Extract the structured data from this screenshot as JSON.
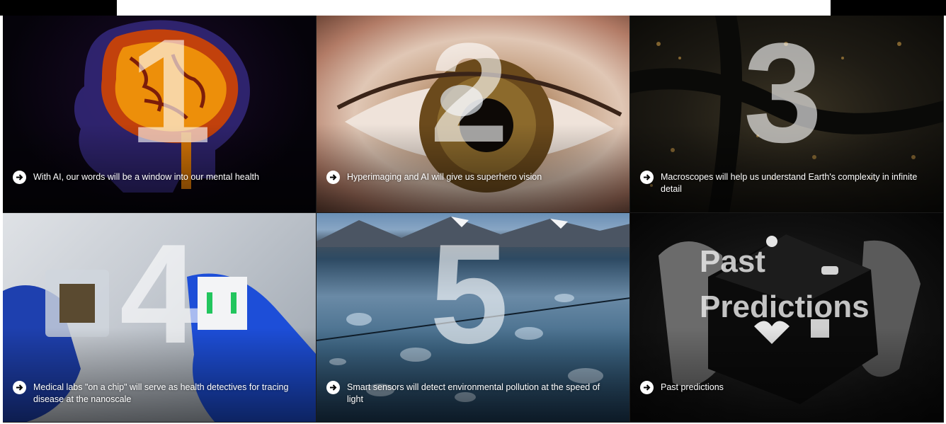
{
  "tiles": [
    {
      "number": "1",
      "caption": "With AI, our words will be a window into our mental health"
    },
    {
      "number": "2",
      "caption": "Hyperimaging and AI will give us superhero vision"
    },
    {
      "number": "3",
      "caption": "Macroscopes will help us understand Earth's complexity in infinite detail"
    },
    {
      "number": "4",
      "caption": "Medical labs \"on a chip\" will serve as health detectives for tracing disease at the nanoscale"
    },
    {
      "number": "5",
      "caption": "Smart sensors will detect environmental pollution at the speed of light"
    },
    {
      "title_line1": "Past",
      "title_line2": "Predictions",
      "caption": "Past predictions"
    }
  ],
  "icons": {
    "arrow": "arrow-right-circle-icon"
  },
  "colors": {
    "caption_text": "#ffffff",
    "arrow_circle": "#ffffff",
    "arrow_glyph": "#000000"
  }
}
